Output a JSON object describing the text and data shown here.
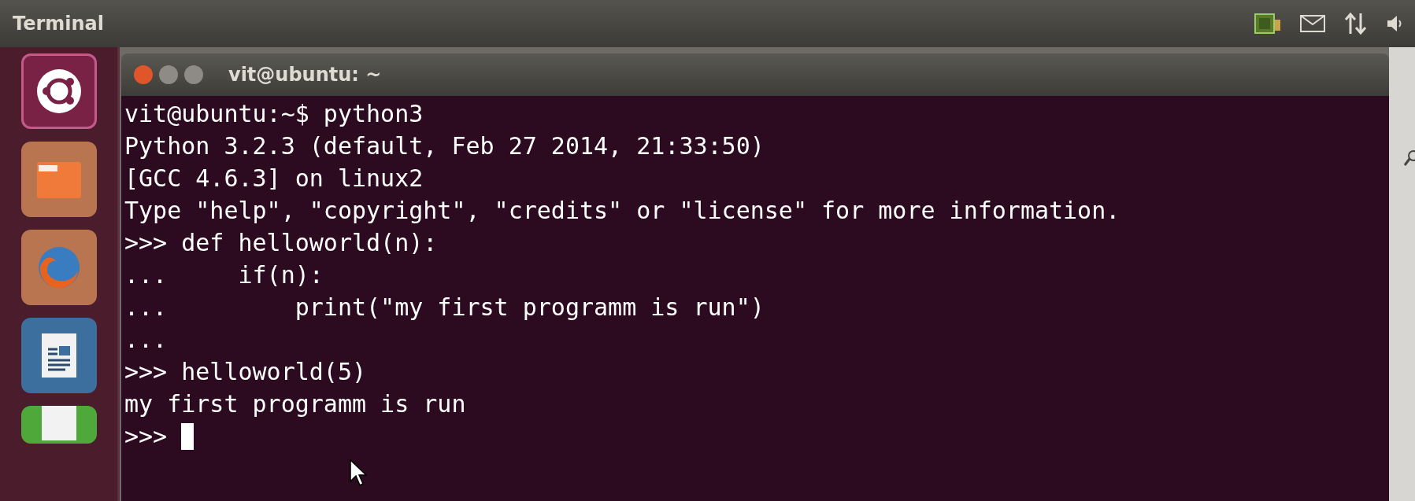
{
  "top_bar": {
    "title": "Terminal"
  },
  "launcher": {
    "items": [
      {
        "kind": "dash",
        "selected": true
      },
      {
        "kind": "files",
        "selected": false
      },
      {
        "kind": "browser",
        "selected": false
      },
      {
        "kind": "impress",
        "selected": false
      },
      {
        "kind": "calc",
        "selected": false
      }
    ]
  },
  "window": {
    "title": "vit@ubuntu: ~"
  },
  "terminal": {
    "lines": [
      "vit@ubuntu:~$ python3",
      "Python 3.2.3 (default, Feb 27 2014, 21:33:50)",
      "[GCC 4.6.3] on linux2",
      "Type \"help\", \"copyright\", \"credits\" or \"license\" for more information.",
      ">>> def helloworld(n):",
      "...     if(n):",
      "...         print(\"my first programm is run\")",
      "...",
      ">>> helloworld(5)",
      "my first programm is run",
      ">>> "
    ]
  }
}
